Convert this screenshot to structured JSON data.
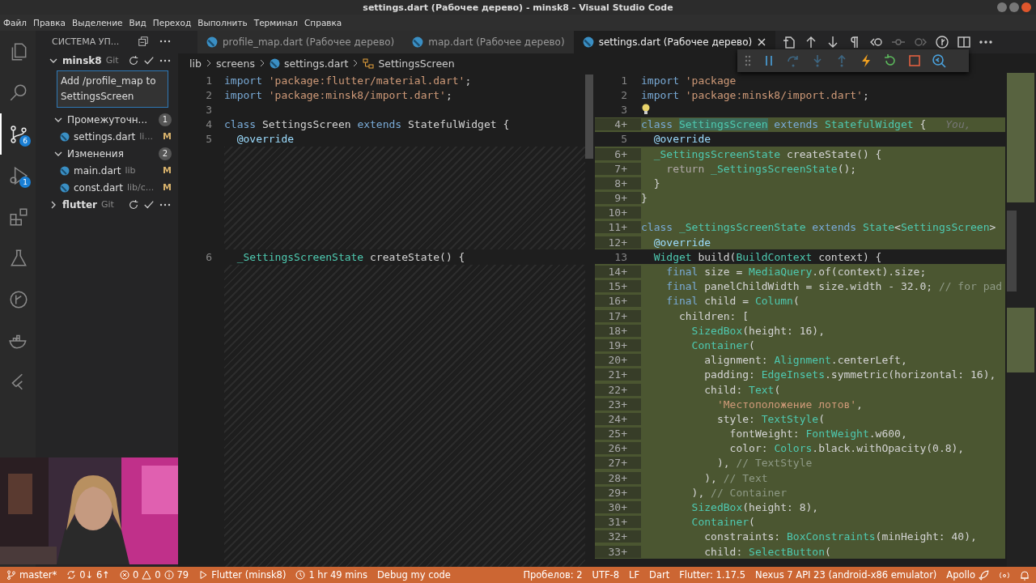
{
  "window": {
    "title": "settings.dart (Рабочее дерево) - minsk8 - Visual Studio Code"
  },
  "menu": [
    "Файл",
    "Правка",
    "Выделение",
    "Вид",
    "Переход",
    "Выполнить",
    "Терминал",
    "Справка"
  ],
  "activity_bar": [
    {
      "kind": "files",
      "selected": false
    },
    {
      "kind": "search",
      "selected": false
    },
    {
      "kind": "source-control",
      "selected": true,
      "badge": "6"
    },
    {
      "kind": "debug",
      "selected": false,
      "badge": "1"
    },
    {
      "kind": "extensions",
      "selected": false
    },
    {
      "kind": "flask",
      "selected": false
    },
    {
      "kind": "git-graph",
      "selected": false
    },
    {
      "kind": "docker",
      "selected": false
    },
    {
      "kind": "flutter",
      "selected": false
    }
  ],
  "sidebar": {
    "title": "СИСТЕМА УП...",
    "repos": [
      {
        "name": "minsk8",
        "provider": "Git",
        "expanded": true,
        "commit_message": "Add /profile_map to SettingsScreen",
        "groups": [
          {
            "label": "Промежуточн...",
            "count": "1",
            "files": [
              {
                "name": "settings.dart",
                "path": "li...",
                "status": "M"
              }
            ]
          },
          {
            "label": "Изменения",
            "count": "2",
            "files": [
              {
                "name": "main.dart",
                "path": "lib",
                "status": "M"
              },
              {
                "name": "const.dart",
                "path": "lib/c...",
                "status": "M"
              }
            ]
          }
        ]
      },
      {
        "name": "flutter",
        "provider": "Git",
        "expanded": false
      }
    ]
  },
  "tabs": [
    {
      "label": "profile_map.dart (Рабочее дерево)",
      "selected": false
    },
    {
      "label": "map.dart (Рабочее дерево)",
      "selected": false
    },
    {
      "label": "settings.dart (Рабочее дерево)",
      "selected": true
    }
  ],
  "tab_actions": [
    {
      "kind": "open-file"
    },
    {
      "kind": "up"
    },
    {
      "kind": "down"
    },
    {
      "kind": "pilcrow"
    },
    {
      "kind": "back"
    },
    {
      "kind": "dot"
    },
    {
      "kind": "forward"
    },
    {
      "kind": "merge"
    },
    {
      "kind": "split"
    },
    {
      "kind": "more"
    }
  ],
  "breadcrumb": [
    "lib",
    "screens",
    "settings.dart",
    "SettingsScreen"
  ],
  "debug_toolbar": [
    {
      "kind": "pause",
      "disabled": false
    },
    {
      "kind": "step-over",
      "disabled": true
    },
    {
      "kind": "step-into",
      "disabled": true
    },
    {
      "kind": "step-out",
      "disabled": true
    },
    {
      "kind": "hot-reload",
      "disabled": false
    },
    {
      "kind": "restart",
      "disabled": false
    },
    {
      "kind": "stop",
      "disabled": false
    },
    {
      "kind": "inspect",
      "disabled": false
    }
  ],
  "left_editor": [
    {
      "kind": "line",
      "num": "1",
      "segs": [
        {
          "t": "import",
          "kind": "kw"
        },
        {
          "t": " 'package:flutter/material.dart'",
          "kind": "str"
        },
        {
          "t": ";",
          "kind": "p"
        }
      ]
    },
    {
      "kind": "line",
      "num": "2",
      "segs": [
        {
          "t": "import",
          "kind": "kw"
        },
        {
          "t": " 'package:minsk8/import.dart'",
          "kind": "str"
        },
        {
          "t": ";",
          "kind": "p"
        }
      ]
    },
    {
      "kind": "line",
      "num": "3"
    },
    {
      "kind": "line",
      "num": "4",
      "segs": [
        {
          "t": "class",
          "kind": "kw"
        },
        {
          "t": " SettingsScreen ",
          "kind": "p"
        },
        {
          "t": "extends",
          "kind": "kw"
        },
        {
          "t": " StatefulWidget {",
          "kind": "p"
        }
      ]
    },
    {
      "kind": "line",
      "num": "5",
      "segs": [
        {
          "t": "  @override",
          "kind": "ann"
        }
      ]
    },
    {
      "kind": "gap"
    },
    {
      "kind": "line",
      "num": "6",
      "segs": [
        {
          "t": "  _SettingsScreenState",
          "kind": "type"
        },
        {
          "t": " createState() {",
          "kind": "p"
        }
      ]
    },
    {
      "kind": "gap"
    }
  ],
  "right_editor": [
    {
      "num": "1",
      "added": false,
      "segs": [
        {
          "t": "import",
          "kind": "kw"
        },
        {
          "t": " 'package",
          "kind": "str"
        }
      ]
    },
    {
      "num": "2",
      "added": false,
      "segs": [
        {
          "t": "import",
          "kind": "kw"
        },
        {
          "t": " 'package:minsk8/import.dart'",
          "kind": "str"
        },
        {
          "t": ";",
          "kind": "p"
        }
      ]
    },
    {
      "num": "3",
      "added": false,
      "lightbulb": true
    },
    {
      "num": "4+",
      "added": true,
      "blame": "You,",
      "segs": [
        {
          "t": "class ",
          "kind": "kw"
        },
        {
          "t": "SettingsScreen",
          "kind": "hl"
        },
        {
          "t": " extends",
          "kind": "kw"
        },
        {
          "t": " StatefulWidget",
          "kind": "type"
        },
        {
          "t": " {",
          "kind": "p"
        }
      ]
    },
    {
      "num": "5",
      "added": false,
      "segs": [
        {
          "t": "  @override",
          "kind": "ann"
        }
      ]
    },
    {
      "num": "6+",
      "added": true,
      "segs": [
        {
          "t": "  _SettingsScreenState",
          "kind": "type"
        },
        {
          "t": " createState() {",
          "kind": "p"
        }
      ]
    },
    {
      "num": "7+",
      "added": true,
      "segs": [
        {
          "t": "    return",
          "kind": "kw2"
        },
        {
          "t": " _SettingsScreenState",
          "kind": "type"
        },
        {
          "t": "();",
          "kind": "p"
        }
      ]
    },
    {
      "num": "8+",
      "added": true,
      "segs": [
        {
          "t": "  }",
          "kind": "p"
        }
      ]
    },
    {
      "num": "9+",
      "added": true,
      "segs": [
        {
          "t": "}",
          "kind": "p"
        }
      ]
    },
    {
      "num": "10+",
      "added": true
    },
    {
      "num": "11+",
      "added": true,
      "segs": [
        {
          "t": "class",
          "kind": "kw"
        },
        {
          "t": " _SettingsScreenState ",
          "kind": "type"
        },
        {
          "t": "extends",
          "kind": "kw"
        },
        {
          "t": " State",
          "kind": "type"
        },
        {
          "t": "<",
          "kind": "p"
        },
        {
          "t": "SettingsScreen",
          "kind": "type"
        },
        {
          "t": ">",
          "kind": "p"
        }
      ]
    },
    {
      "num": "12+",
      "added": true,
      "segs": [
        {
          "t": "  @override",
          "kind": "ann"
        }
      ]
    },
    {
      "num": "13",
      "added": false,
      "segs": [
        {
          "t": "  Widget",
          "kind": "type"
        },
        {
          "t": " build(",
          "kind": "p"
        },
        {
          "t": "BuildContext",
          "kind": "type"
        },
        {
          "t": " context) {",
          "kind": "p"
        }
      ]
    },
    {
      "num": "14+",
      "added": true,
      "segs": [
        {
          "t": "    final",
          "kind": "kw"
        },
        {
          "t": " size = ",
          "kind": "p"
        },
        {
          "t": "MediaQuery",
          "kind": "type"
        },
        {
          "t": ".of(context).size;",
          "kind": "p"
        }
      ]
    },
    {
      "num": "15+",
      "added": true,
      "segs": [
        {
          "t": "    final",
          "kind": "kw"
        },
        {
          "t": " panelChildWidth = size.width - 32.0; ",
          "kind": "p"
        },
        {
          "t": "// for pad",
          "kind": "cmt"
        }
      ]
    },
    {
      "num": "16+",
      "added": true,
      "segs": [
        {
          "t": "    final",
          "kind": "kw"
        },
        {
          "t": " child = ",
          "kind": "p"
        },
        {
          "t": "Column",
          "kind": "type"
        },
        {
          "t": "(",
          "kind": "p"
        }
      ]
    },
    {
      "num": "17+",
      "added": true,
      "segs": [
        {
          "t": "      children: [",
          "kind": "p"
        }
      ]
    },
    {
      "num": "18+",
      "added": true,
      "segs": [
        {
          "t": "        SizedBox",
          "kind": "type"
        },
        {
          "t": "(height: 16),",
          "kind": "p"
        }
      ]
    },
    {
      "num": "19+",
      "added": true,
      "segs": [
        {
          "t": "        Container",
          "kind": "type"
        },
        {
          "t": "(",
          "kind": "p"
        }
      ]
    },
    {
      "num": "20+",
      "added": true,
      "segs": [
        {
          "t": "          alignment: ",
          "kind": "p"
        },
        {
          "t": "Alignment",
          "kind": "type"
        },
        {
          "t": ".centerLeft,",
          "kind": "p"
        }
      ]
    },
    {
      "num": "21+",
      "added": true,
      "segs": [
        {
          "t": "          padding: ",
          "kind": "p"
        },
        {
          "t": "EdgeInsets",
          "kind": "type"
        },
        {
          "t": ".symmetric(horizontal: 16),",
          "kind": "p"
        }
      ]
    },
    {
      "num": "22+",
      "added": true,
      "segs": [
        {
          "t": "          child: ",
          "kind": "p"
        },
        {
          "t": "Text",
          "kind": "type"
        },
        {
          "t": "(",
          "kind": "p"
        }
      ]
    },
    {
      "num": "23+",
      "added": true,
      "segs": [
        {
          "t": "            'Местоположение лотов'",
          "kind": "str"
        },
        {
          "t": ",",
          "kind": "p"
        }
      ]
    },
    {
      "num": "24+",
      "added": true,
      "segs": [
        {
          "t": "            style: ",
          "kind": "p"
        },
        {
          "t": "TextStyle",
          "kind": "type"
        },
        {
          "t": "(",
          "kind": "p"
        }
      ]
    },
    {
      "num": "25+",
      "added": true,
      "segs": [
        {
          "t": "              fontWeight: ",
          "kind": "p"
        },
        {
          "t": "FontWeight",
          "kind": "type"
        },
        {
          "t": ".w600,",
          "kind": "p"
        }
      ]
    },
    {
      "num": "26+",
      "added": true,
      "segs": [
        {
          "t": "              color: ",
          "kind": "p"
        },
        {
          "t": "Colors",
          "kind": "type"
        },
        {
          "t": ".black.withOpacity(0.8),",
          "kind": "p"
        }
      ]
    },
    {
      "num": "27+",
      "added": true,
      "segs": [
        {
          "t": "            ), ",
          "kind": "p"
        },
        {
          "t": "// TextStyle",
          "kind": "cmt"
        }
      ]
    },
    {
      "num": "28+",
      "added": true,
      "segs": [
        {
          "t": "          ), ",
          "kind": "p"
        },
        {
          "t": "// Text",
          "kind": "cmt"
        }
      ]
    },
    {
      "num": "29+",
      "added": true,
      "segs": [
        {
          "t": "        ), ",
          "kind": "p"
        },
        {
          "t": "// Container",
          "kind": "cmt"
        }
      ]
    },
    {
      "num": "30+",
      "added": true,
      "segs": [
        {
          "t": "        SizedBox",
          "kind": "type"
        },
        {
          "t": "(height: 8),",
          "kind": "p"
        }
      ]
    },
    {
      "num": "31+",
      "added": true,
      "segs": [
        {
          "t": "        Container",
          "kind": "type"
        },
        {
          "t": "(",
          "kind": "p"
        }
      ]
    },
    {
      "num": "32+",
      "added": true,
      "segs": [
        {
          "t": "          constraints: ",
          "kind": "p"
        },
        {
          "t": "BoxConstraints",
          "kind": "type"
        },
        {
          "t": "(minHeight: 40),",
          "kind": "p"
        }
      ]
    },
    {
      "num": "33+",
      "added": true,
      "segs": [
        {
          "t": "          child: ",
          "kind": "p"
        },
        {
          "t": "SelectButton",
          "kind": "type"
        },
        {
          "t": "(",
          "kind": "p"
        }
      ]
    }
  ],
  "status_bar": {
    "left": [
      {
        "kind": "branch",
        "text": "master*"
      },
      {
        "kind": "sync",
        "text": "0↓ 6↑"
      },
      {
        "kind": "problems",
        "errors": "0",
        "warnings": "0",
        "infos": "79"
      },
      {
        "kind": "run",
        "text": "Flutter (minsk8)"
      },
      {
        "kind": "history",
        "text": "1 hr 49 mins"
      },
      {
        "kind": "plain",
        "text": "Debug my code"
      }
    ],
    "right": [
      {
        "kind": "plain",
        "text": "Пробелов: 2"
      },
      {
        "kind": "plain",
        "text": "UTF-8"
      },
      {
        "kind": "plain",
        "text": "LF"
      },
      {
        "kind": "plain",
        "text": "Dart"
      },
      {
        "kind": "plain",
        "text": "Flutter: 1.17.5"
      },
      {
        "kind": "plain",
        "text": "Nexus 7 API 23 (android-x86 emulator)"
      },
      {
        "kind": "rocket",
        "text": "Apollo"
      },
      {
        "kind": "broadcast"
      },
      {
        "kind": "bell"
      }
    ]
  }
}
